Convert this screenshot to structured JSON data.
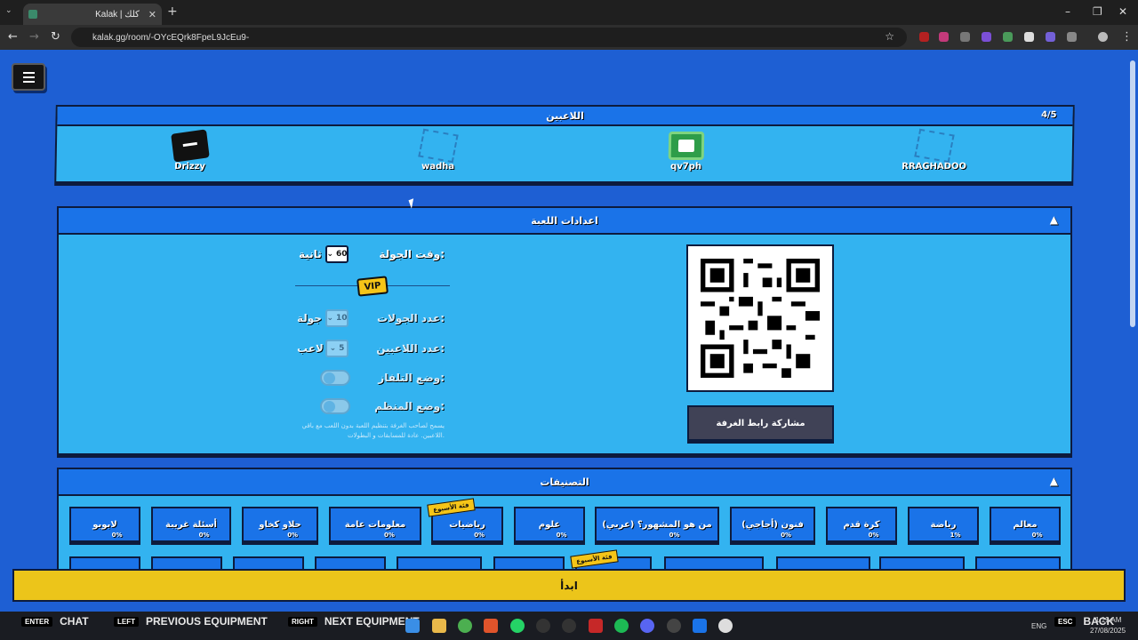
{
  "browser": {
    "tab_title": "Kalak | كلك",
    "url": "kalak.gg/room/-OYcEQrk8FpeL9JcEu9-"
  },
  "players_panel": {
    "title": "اللاعبين",
    "count": "4/5",
    "players": [
      "Drizzy",
      "wadha",
      "qv7ph",
      "RRAGHADOO"
    ]
  },
  "settings_panel": {
    "title": "اعدادات اللعبة",
    "round_time_label": "وقت الجولة:",
    "round_time_value": "60",
    "round_time_unit": "ثانية",
    "vip_badge": "VIP",
    "rounds_label": "عدد الجولات:",
    "rounds_value": "10",
    "rounds_unit": "جولة",
    "players_label": "عدد اللاعبين:",
    "players_value": "5",
    "players_unit": "لاعب",
    "tv_mode_label": "وضع التلفاز:",
    "organizer_mode_label": "وضع المنظم:",
    "organizer_note": "يسمح لصاحب الغرفة بتنظيم اللعبة بدون اللعب مع باقي اللاعبين. عادة للمسابقات و البطولات.",
    "share_button": "مشاركة رابط الغرفة"
  },
  "categories_panel": {
    "title": "التصنيفات",
    "weekly_ribbon": "فئة الأسبوع",
    "items": [
      {
        "name": "معالم",
        "pct": "0%"
      },
      {
        "name": "رياضة",
        "pct": "1%"
      },
      {
        "name": "كرة قدم",
        "pct": "0%"
      },
      {
        "name": "فنون (أجاجي)",
        "pct": "0%"
      },
      {
        "name": "من هو المشهور؟ (عربي)",
        "pct": "0%"
      },
      {
        "name": "علوم",
        "pct": "0%"
      },
      {
        "name": "رياضيات",
        "pct": "0%"
      },
      {
        "name": "معلومات عامة",
        "pct": "0%"
      },
      {
        "name": "حلاو كخاو",
        "pct": "0%"
      },
      {
        "name": "أسئلة غريبة",
        "pct": "0%"
      },
      {
        "name": "لابوبو",
        "pct": "0%"
      }
    ]
  },
  "start_button": "ابدأ",
  "key_hints": [
    {
      "key": "ENTER",
      "action": "CHAT"
    },
    {
      "key": "LEFT",
      "action": "PREVIOUS EQUIPMENT"
    },
    {
      "key": "RIGHT",
      "action": "NEXT EQUIPMENT"
    },
    {
      "key": "ESC",
      "action": "BACK"
    }
  ],
  "taskbar": {
    "lang": "ENG",
    "time": "1:19 AM",
    "date": "27/08/2025"
  }
}
